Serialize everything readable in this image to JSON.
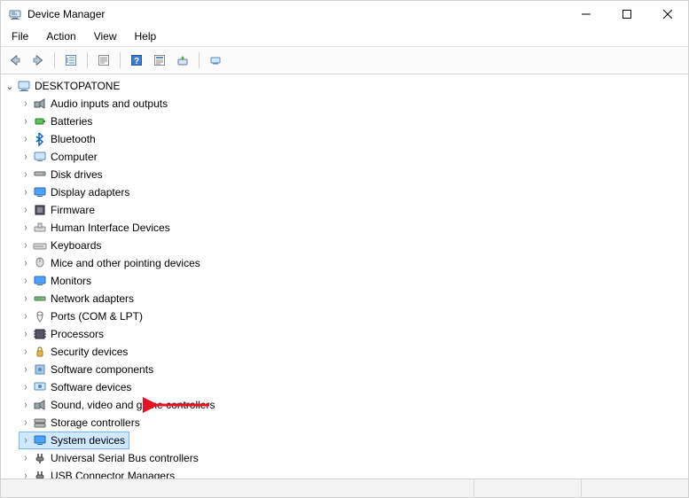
{
  "window": {
    "title": "Device Manager"
  },
  "menu": {
    "file": "File",
    "action": "Action",
    "view": "View",
    "help": "Help"
  },
  "tree": {
    "root": "DESKTOPATONE",
    "items": [
      "Audio inputs and outputs",
      "Batteries",
      "Bluetooth",
      "Computer",
      "Disk drives",
      "Display adapters",
      "Firmware",
      "Human Interface Devices",
      "Keyboards",
      "Mice and other pointing devices",
      "Monitors",
      "Network adapters",
      "Ports (COM & LPT)",
      "Processors",
      "Security devices",
      "Software components",
      "Software devices",
      "Sound, video and game controllers",
      "Storage controllers",
      "System devices",
      "Universal Serial Bus controllers",
      "USB Connector Managers"
    ],
    "selected_index": 19
  },
  "colors": {
    "selection_bg": "#cde8ff",
    "selection_border": "#7ab7ef",
    "arrow": "#e81123"
  }
}
